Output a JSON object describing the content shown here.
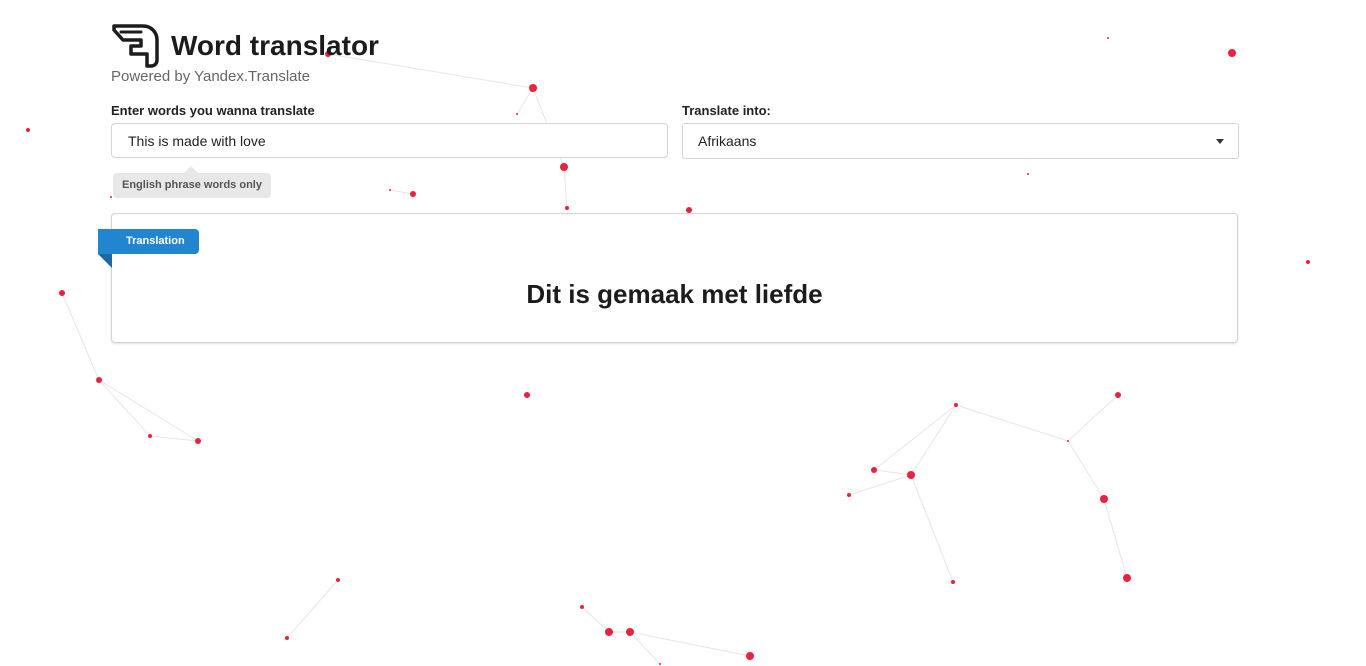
{
  "header": {
    "title": "Word translator",
    "subtitle": "Powered by Yandex.Translate",
    "logo_icon": "winged-hand-logo"
  },
  "input": {
    "label": "Enter words you wanna translate",
    "value": "This is made with love",
    "hint": "English phrase words only"
  },
  "language": {
    "label": "Translate into:",
    "selected": "Afrikaans"
  },
  "result": {
    "ribbon_label": "Translation",
    "text": "Dit is gemaak met liefde"
  },
  "colors": {
    "accent": "#2185d0",
    "particle": "#e8223f",
    "border": "#d4d4d5"
  }
}
